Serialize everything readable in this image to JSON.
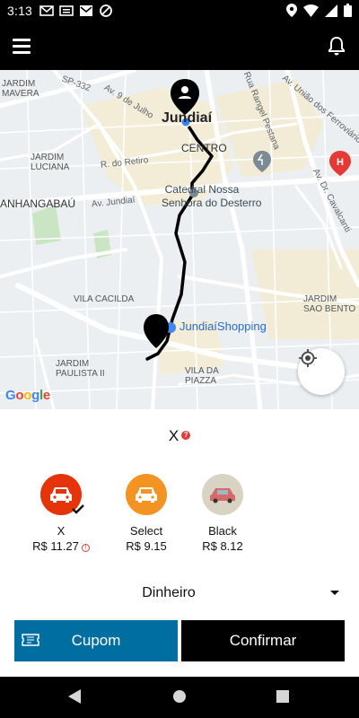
{
  "status_bar": {
    "time": "3:13",
    "left_icons": [
      "gmail-icon",
      "alert-icon",
      "mail-icon",
      "blocked-icon"
    ],
    "right_icons": [
      "location-icon",
      "wifi-icon",
      "signal-icon",
      "battery-icon"
    ]
  },
  "app_bar": {
    "menu_icon": "menu-icon",
    "notification_icon": "bell-icon"
  },
  "map": {
    "labels": {
      "jardim_mavera": "JARDIM\nMAVERA",
      "sp332": "SP-332",
      "av_9_julho": "Av. 9 de Julho",
      "rua_rangel": "Rua Rangel Pestana",
      "av_uniao": "Av. União dos Ferroviários",
      "city": "Jundiaí",
      "centro": "CENTRO",
      "jardim_luciana": "JARDIM\nLUCIANA",
      "r_retiro": "R. do Retiro",
      "catedral": "Catedral Nossa\nSenhora do Desterro",
      "av_cavalcanti": "Av. Dr. Cavalcanti",
      "anhangabau": "ANHANGABAÚ",
      "av_jundiai": "Av. Jundiaí",
      "vila_cacilda": "VILA CACILDA",
      "jardim_sao_bento": "JARDIM\nSAO BENTO",
      "shopping": "JundiaíShopping",
      "jardim_paulista": "JARDIM\nPAULISTA II",
      "vila_piazza": "VILA DA\nPIAZZA",
      "google": [
        "G",
        "o",
        "o",
        "g",
        "l",
        "e"
      ]
    },
    "locate_icon": "my-location-icon"
  },
  "sheet": {
    "selected_category": "X",
    "categories": [
      {
        "name": "X",
        "price": "R$ 11.27",
        "color": "#e5340a",
        "selected": true
      },
      {
        "name": "Select",
        "price": "R$ 9.15",
        "color": "#f39322"
      },
      {
        "name": "Black",
        "price": "R$ 8.12",
        "color": "#d9d3c3"
      }
    ],
    "payment": "Dinheiro",
    "buttons": {
      "coupon": "Cupom",
      "confirm": "Confirmar"
    }
  },
  "colors": {
    "coupon_button": "#006ea0",
    "confirm_button": "#000000",
    "accent_red": "#e53935"
  }
}
